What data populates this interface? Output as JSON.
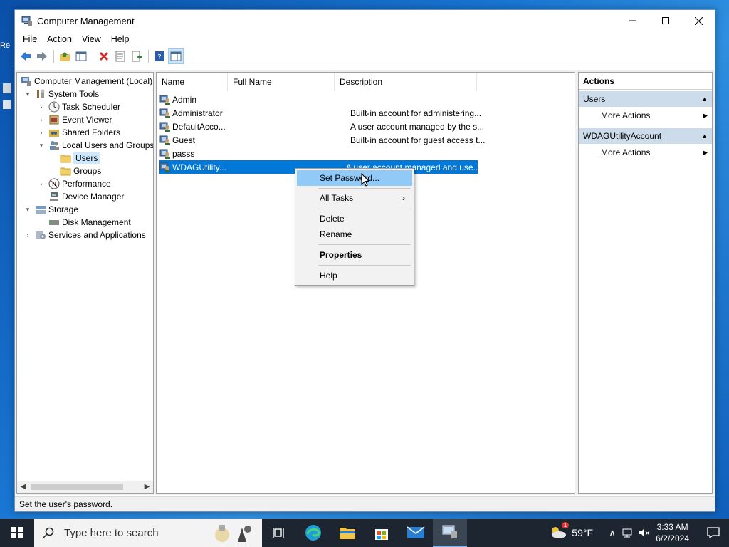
{
  "window": {
    "title": "Computer Management",
    "minimize_icon": "minimize-icon",
    "maximize_icon": "maximize-icon",
    "close_icon": "close-icon"
  },
  "menu": [
    "File",
    "Action",
    "View",
    "Help"
  ],
  "tree": {
    "root": "Computer Management (Local)",
    "system_tools": "System Tools",
    "task_scheduler": "Task Scheduler",
    "event_viewer": "Event Viewer",
    "shared_folders": "Shared Folders",
    "local_users_groups": "Local Users and Groups",
    "users": "Users",
    "groups": "Groups",
    "performance": "Performance",
    "device_manager": "Device Manager",
    "storage": "Storage",
    "disk_management": "Disk Management",
    "services_apps": "Services and Applications"
  },
  "list": {
    "columns": [
      "Name",
      "Full Name",
      "Description"
    ],
    "rows": [
      {
        "name": "Admin",
        "full_name": "",
        "description": ""
      },
      {
        "name": "Administrator",
        "full_name": "",
        "description": "Built-in account for administering..."
      },
      {
        "name": "DefaultAcco...",
        "full_name": "",
        "description": "A user account managed by the s..."
      },
      {
        "name": "Guest",
        "full_name": "",
        "description": "Built-in account for guest access t..."
      },
      {
        "name": "passs",
        "full_name": "",
        "description": ""
      },
      {
        "name": "WDAGUtility...",
        "full_name": "",
        "description": "A user account managed and use..."
      }
    ]
  },
  "actions": {
    "header": "Actions",
    "section1": "Users",
    "more1": "More Actions",
    "section2": "WDAGUtilityAccount",
    "more2": "More Actions"
  },
  "context_menu": {
    "set_password": "Set Password...",
    "all_tasks": "All Tasks",
    "delete": "Delete",
    "rename": "Rename",
    "properties": "Properties",
    "help": "Help"
  },
  "status": "Set the user's password.",
  "taskbar": {
    "search_placeholder": "Type here to search",
    "temperature": "59°F",
    "time": "3:33 AM",
    "date": "6/2/2024",
    "weather_badge": "1"
  },
  "colors": {
    "selection": "#0078d7",
    "menu_highlight": "#91c9f7",
    "action_section": "#cddcea",
    "taskbar": "#1c2530"
  }
}
